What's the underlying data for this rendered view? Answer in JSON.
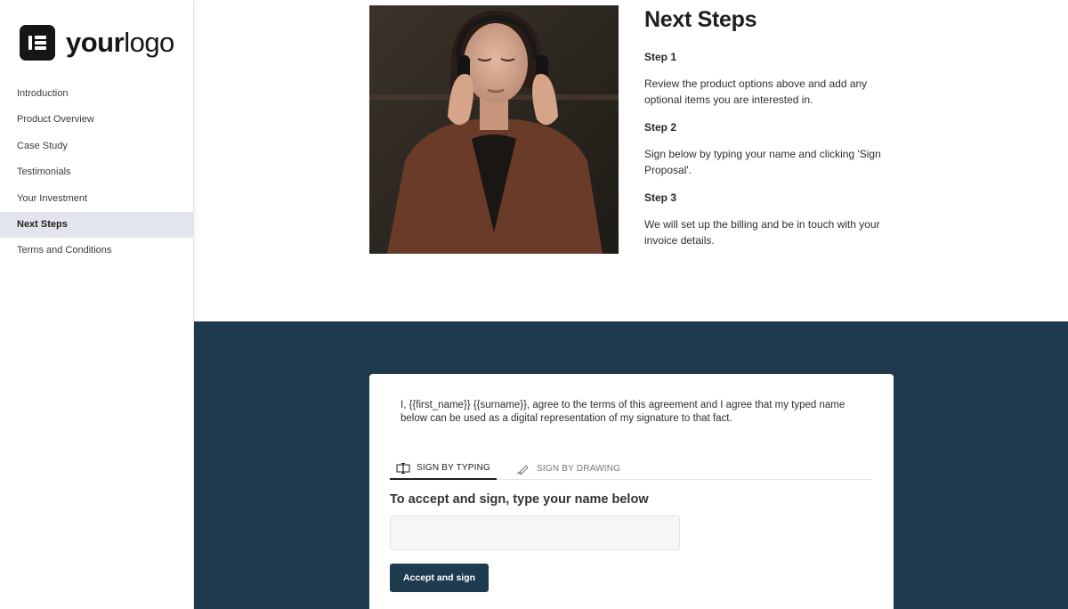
{
  "logo": {
    "icon": "logo-mark-icon",
    "text_bold": "your",
    "text_light": "logo"
  },
  "sidebar": {
    "items": [
      {
        "label": "Introduction",
        "active": false
      },
      {
        "label": "Product Overview",
        "active": false
      },
      {
        "label": "Case Study",
        "active": false
      },
      {
        "label": "Testimonials",
        "active": false
      },
      {
        "label": "Your Investment",
        "active": false
      },
      {
        "label": "Next Steps",
        "active": true
      },
      {
        "label": "Terms and Conditions",
        "active": false
      }
    ]
  },
  "main": {
    "title": "Next Steps",
    "steps": [
      {
        "title": "Step 1",
        "text": "Review the product options above and add any optional items you are interested in."
      },
      {
        "title": "Step 2",
        "text": "Sign below by typing your name and clicking 'Sign Proposal'."
      },
      {
        "title": "Step 3",
        "text": "We will set up the billing and be in touch with your invoice details."
      }
    ]
  },
  "signature": {
    "agreement": "I, {{first_name}} {{surname}}, agree to the terms of this agreement and I agree that my typed name below can be used as a digital representation of my signature to that fact.",
    "tab_typing": "SIGN BY TYPING",
    "tab_drawing": "SIGN BY DRAWING",
    "prompt": "To accept and sign, type your name below",
    "input_value": "",
    "input_placeholder": "",
    "button_label": "Accept and sign"
  },
  "colors": {
    "band": "#203a4d",
    "button": "#1f3b4f",
    "active_nav": "#e3e5ec"
  }
}
